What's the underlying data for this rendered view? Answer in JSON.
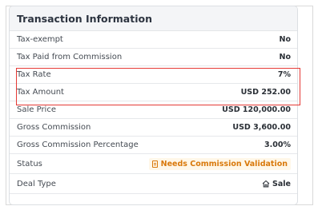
{
  "section": {
    "title": "Transaction Information"
  },
  "rows": [
    {
      "label": "Tax-exempt",
      "value": "No"
    },
    {
      "label": "Tax Paid from Commission",
      "value": "No"
    },
    {
      "label": "Tax Rate",
      "value": "7%"
    },
    {
      "label": "Tax Amount",
      "value": "USD 252.00"
    },
    {
      "label": "Sale Price",
      "value": "USD 120,000.00"
    },
    {
      "label": "Gross Commission",
      "value": "USD 3,600.00"
    },
    {
      "label": "Gross Commission Percentage",
      "value": "3.00%"
    },
    {
      "label": "Status",
      "value": "Needs Commission Validation",
      "icon": "document-icon",
      "color": "#d9790b"
    },
    {
      "label": "Deal Type",
      "value": "Sale",
      "icon": "home-icon"
    }
  ],
  "highlight_color": "#e53935"
}
